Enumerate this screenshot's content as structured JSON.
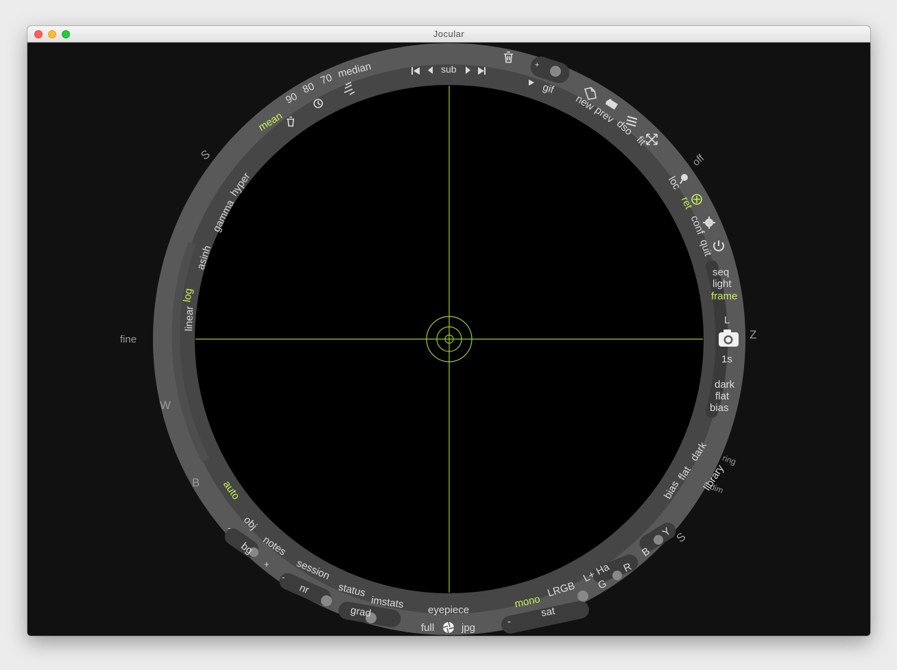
{
  "window": {
    "title": "Jocular"
  },
  "colors": {
    "accent": "#c8f25a",
    "text": "#dcdcdc",
    "dim": "#9a9a9a",
    "ring": "#595959",
    "inner_ring": "#444444",
    "background": "#111111"
  },
  "outer_labels": {
    "compass_n": "S",
    "compass_w": "W",
    "compass_e": "Z",
    "compass_s": "S",
    "b": "B",
    "fine": "fine",
    "off": "off",
    "ring": "ring",
    "dim": "dim"
  },
  "stacking": {
    "median": "median",
    "p70": "70",
    "p80": "80",
    "p90": "90",
    "mean": "mean"
  },
  "transform": {
    "hyper": "hyper",
    "gamma": "gamma",
    "asinh": "asinh",
    "log": "log",
    "linear": "linear"
  },
  "nav": {
    "sub": "sub",
    "gif": "gif"
  },
  "file": {
    "new": "new",
    "prev": "prev",
    "dso": "dso",
    "fit": "fit"
  },
  "tools": {
    "loc": "loc",
    "ret": "ret",
    "conf": "conf",
    "quit": "quit"
  },
  "capture": {
    "seq": "seq",
    "light": "light",
    "frame": "frame",
    "filter": "L",
    "exposure": "1s",
    "dark": "dark",
    "flat": "flat",
    "bias": "bias"
  },
  "library": {
    "bias": "bias",
    "flat": "flat",
    "dark": "dark",
    "library": "library"
  },
  "lrgb": {
    "b": "B",
    "y": "Y",
    "r": "R",
    "g": "G",
    "lha": "L+ Ha",
    "lrgb": "LRGB",
    "mono": "mono",
    "sat": "sat",
    "minus": "-"
  },
  "bottom": {
    "eyepiece": "eyepiece",
    "full": "full",
    "jpg": "jpg",
    "imstats": "imstats",
    "status": "status",
    "session": "session",
    "notes": "notes",
    "obj": "obj",
    "auto": "auto",
    "grad": "grad",
    "nr": "nr",
    "bg": "bg",
    "minus": "-",
    "plus": "+"
  },
  "zoom": {
    "plus": "+"
  }
}
